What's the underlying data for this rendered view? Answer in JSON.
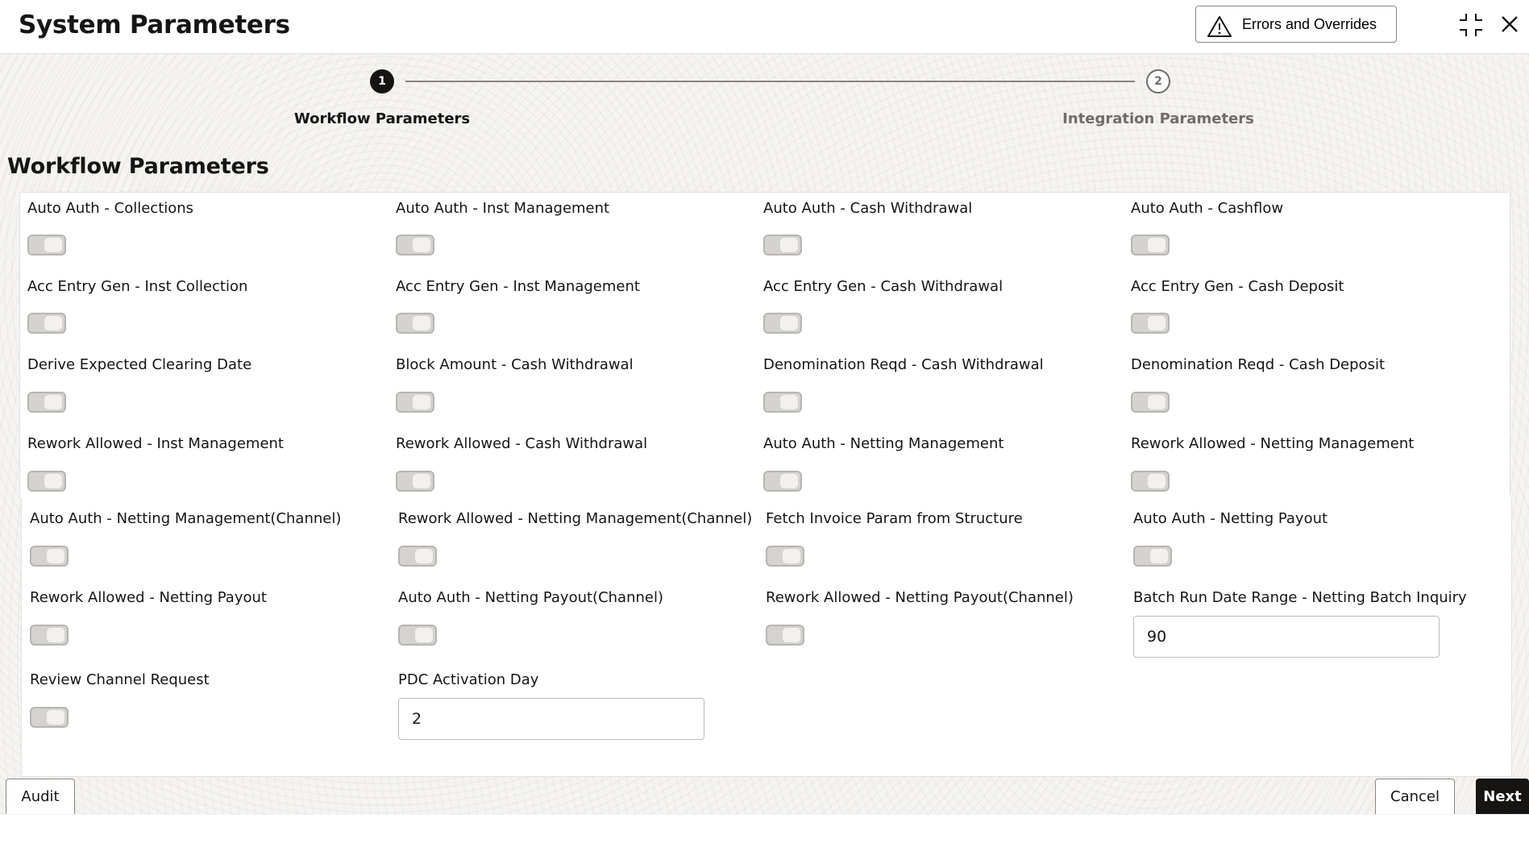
{
  "header": {
    "title": "System Parameters",
    "errors_button": "Errors and Overrides",
    "icons": [
      "warning-icon",
      "minimize-icon",
      "close-icon"
    ]
  },
  "train": {
    "steps": [
      {
        "number": "1",
        "label": "Workflow Parameters",
        "state": "current"
      },
      {
        "number": "2",
        "label": "Integration Parameters",
        "state": "pending"
      }
    ]
  },
  "section": {
    "title": "Workflow Parameters"
  },
  "fields": {
    "auto_auth_collections": "Auto Auth - Collections",
    "auto_auth_inst_management": "Auto Auth - Inst Management",
    "auto_auth_cash_withdrawal": "Auto Auth - Cash Withdrawal",
    "auto_auth_cashflow": "Auto Auth - Cashflow",
    "acc_entry_gen_inst_collection": "Acc Entry Gen - Inst Collection",
    "acc_entry_gen_inst_management": "Acc Entry Gen - Inst Management",
    "acc_entry_gen_cash_withdrawal": "Acc Entry Gen - Cash Withdrawal",
    "acc_entry_gen_cash_deposit": "Acc Entry Gen - Cash Deposit",
    "derive_expected_clearing_date": "Derive Expected Clearing Date",
    "block_amount_cash_withdrawal": "Block Amount - Cash Withdrawal",
    "denomination_reqd_cash_withdrawal": "Denomination Reqd - Cash Withdrawal",
    "denomination_reqd_cash_deposit": "Denomination Reqd - Cash Deposit",
    "rework_allowed_inst_management": "Rework Allowed - Inst Management",
    "rework_allowed_cash_withdrawal": "Rework Allowed - Cash Withdrawal",
    "auto_auth_netting_management": "Auto Auth - Netting Management",
    "rework_allowed_netting_management": "Rework Allowed - Netting Management",
    "auto_auth_netting_management_channel": "Auto Auth - Netting Management(Channel)",
    "rework_allowed_netting_management_channel": "Rework Allowed - Netting Management(Channel)",
    "fetch_invoice_param_from_structure": "Fetch Invoice Param from Structure",
    "auto_auth_netting_payout": "Auto Auth - Netting Payout",
    "rework_allowed_netting_payout": "Rework Allowed - Netting Payout",
    "auto_auth_netting_payout_channel": "Auto Auth - Netting Payout(Channel)",
    "rework_allowed_netting_payout_channel": "Rework Allowed - Netting Payout(Channel)",
    "batch_run_date_range_label": "Batch Run Date Range - Netting Batch Inquiry",
    "batch_run_date_range_value": "90",
    "review_channel_request": "Review Channel Request",
    "pdc_activation_day_label": "PDC Activation Day",
    "pdc_activation_day_value": "2"
  },
  "toggles_state": "off",
  "footer": {
    "audit": "Audit",
    "cancel": "Cancel",
    "next": "Next"
  }
}
